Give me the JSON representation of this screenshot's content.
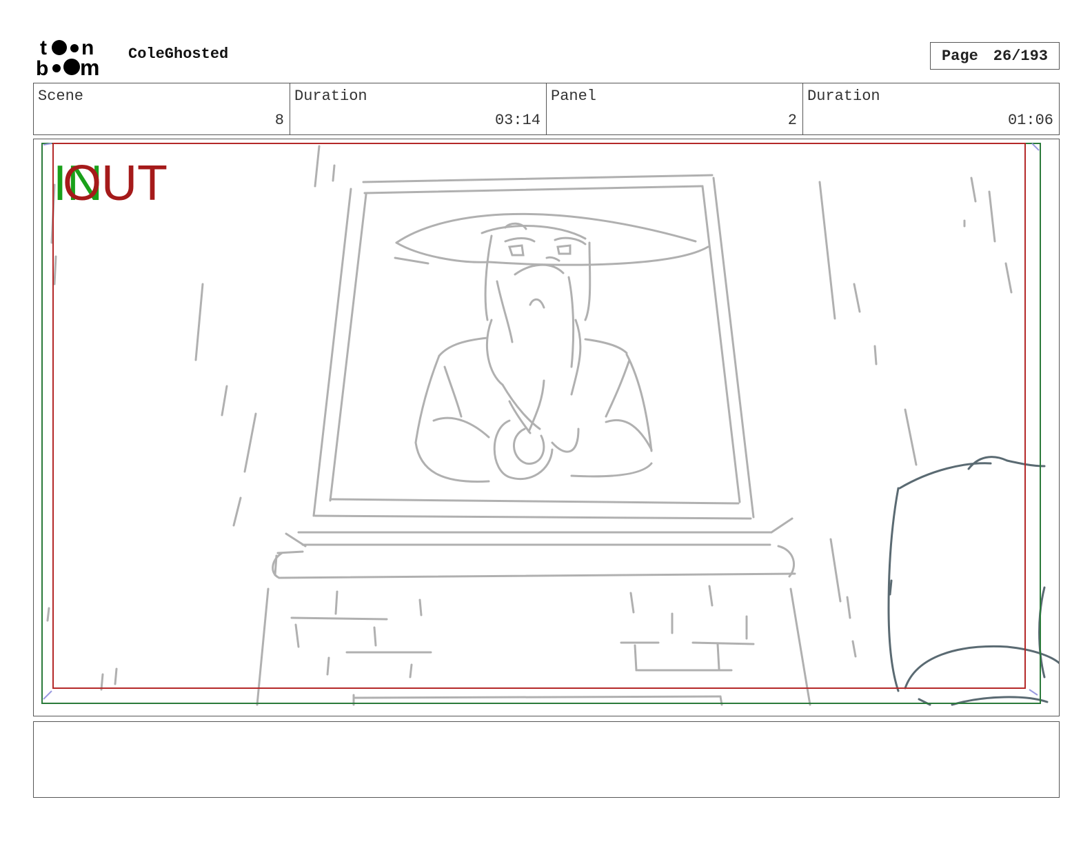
{
  "header": {
    "logo_text": "toon boom",
    "project_name": "ColeGhosted",
    "page_label": "Page",
    "page_value": "26/193"
  },
  "info": {
    "scene_label": "Scene",
    "scene_value": "8",
    "scene_duration_label": "Duration",
    "scene_duration_value": "03:14",
    "panel_label": "Panel",
    "panel_value": "2",
    "panel_duration_label": "Duration",
    "panel_duration_value": "01:06"
  },
  "panel": {
    "in_marker": "IN",
    "out_marker": "OUT",
    "description": "Sketch of a framed portrait of an old bearded man in a wide conical hat, mounted above a brick pedestal; a character's head in the lower right foreground.",
    "colors": {
      "sketch": "#b0b0b0",
      "foreground_character": "#5a6a72",
      "safe_frame_red": "#b42828",
      "safe_frame_green": "#2a7a3a",
      "in_color": "#1aa01a",
      "out_color": "#a51a1a"
    }
  },
  "notes": {
    "text": ""
  }
}
